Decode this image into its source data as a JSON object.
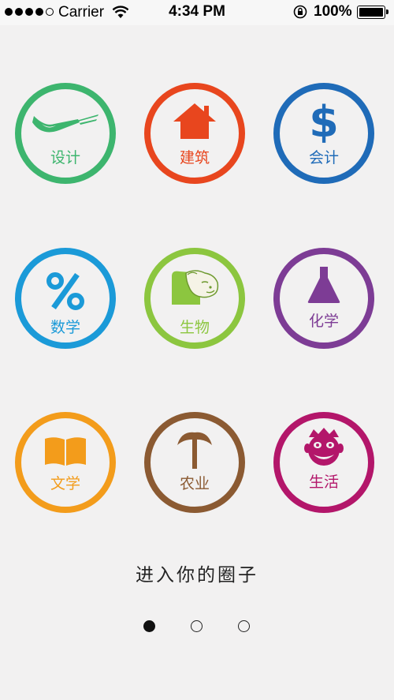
{
  "status_bar": {
    "carrier": "Carrier",
    "time": "4:34 PM",
    "battery": "100%"
  },
  "categories": [
    {
      "label": "设计",
      "color": "#3db56e",
      "icon": "knife-icon"
    },
    {
      "label": "建筑",
      "color": "#e8461e",
      "icon": "house-icon"
    },
    {
      "label": "会计",
      "color": "#1f6bb8",
      "icon": "dollar-icon"
    },
    {
      "label": "数学",
      "color": "#1b9ad8",
      "icon": "percent-icon"
    },
    {
      "label": "生物",
      "color": "#8cc63f",
      "icon": "sheep-icon"
    },
    {
      "label": "化学",
      "color": "#7d3c95",
      "icon": "flask-icon"
    },
    {
      "label": "文学",
      "color": "#f39c1b",
      "icon": "book-icon"
    },
    {
      "label": "农业",
      "color": "#8b5a32",
      "icon": "sprout-icon"
    },
    {
      "label": "生活",
      "color": "#b3166a",
      "icon": "face-icon"
    }
  ],
  "tagline": "进入你的圈子",
  "pager": {
    "total": 3,
    "current": 1
  }
}
